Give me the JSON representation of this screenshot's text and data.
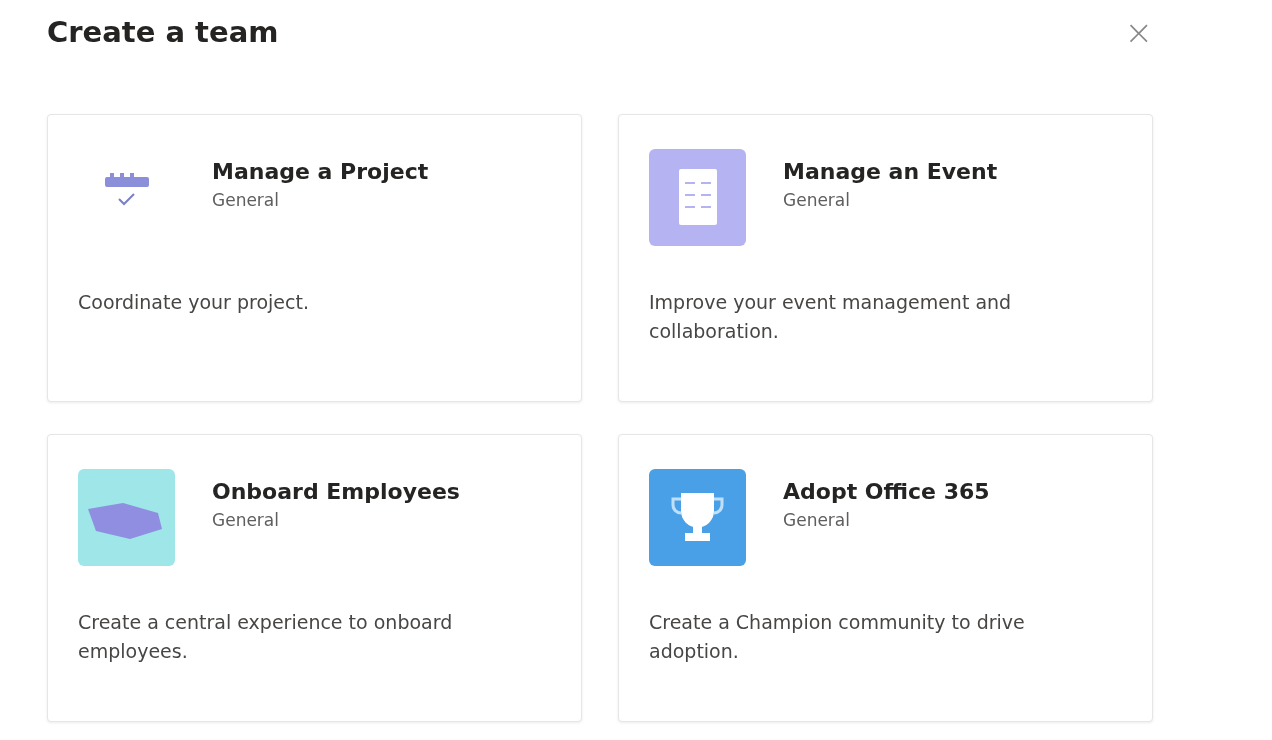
{
  "dialog": {
    "title": "Create a team",
    "close": "×"
  },
  "cards": [
    {
      "kind": "project",
      "title": "Manage a Project",
      "category": "General",
      "description": "Coordinate your project."
    },
    {
      "kind": "event",
      "title": "Manage an Event",
      "category": "General",
      "description": "Improve your event management and collaboration."
    },
    {
      "kind": "onboard",
      "title": "Onboard Employees",
      "category": "General",
      "description": "Create a central experience to onboard employees."
    },
    {
      "kind": "adopt",
      "title": "Adopt Office 365",
      "category": "General",
      "description": "Create a Champion community to drive adoption."
    }
  ]
}
